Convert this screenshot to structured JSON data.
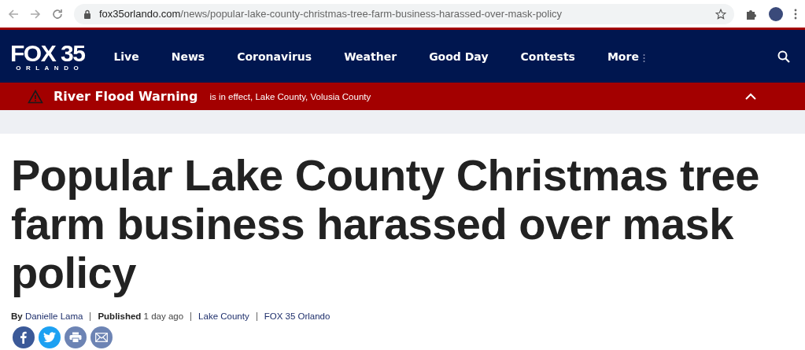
{
  "browser": {
    "url_host": "fox35orlando.com",
    "url_path": "/news/popular-lake-county-christmas-tree-farm-business-harassed-over-mask-policy"
  },
  "logo": {
    "main": "FOX 35",
    "sub": "ORLANDO"
  },
  "nav": [
    {
      "label": "Live"
    },
    {
      "label": "News"
    },
    {
      "label": "Coronavirus"
    },
    {
      "label": "Weather"
    },
    {
      "label": "Good Day"
    },
    {
      "label": "Contests"
    },
    {
      "label": "More",
      "kind": "more"
    }
  ],
  "alert": {
    "title": "River Flood Warning",
    "text": "is in effect, Lake County, Volusia County",
    "expanded": false
  },
  "headline": "Popular Lake County Christmas tree farm business harassed over mask policy",
  "byline": {
    "author_label": "By",
    "author": "Danielle Lama",
    "published_label": "Published",
    "published": "1 day ago",
    "tags": [
      "Lake County",
      "FOX 35 Orlando"
    ]
  },
  "share": [
    {
      "kind": "facebook"
    },
    {
      "kind": "twitter"
    },
    {
      "kind": "print"
    },
    {
      "kind": "email"
    }
  ]
}
